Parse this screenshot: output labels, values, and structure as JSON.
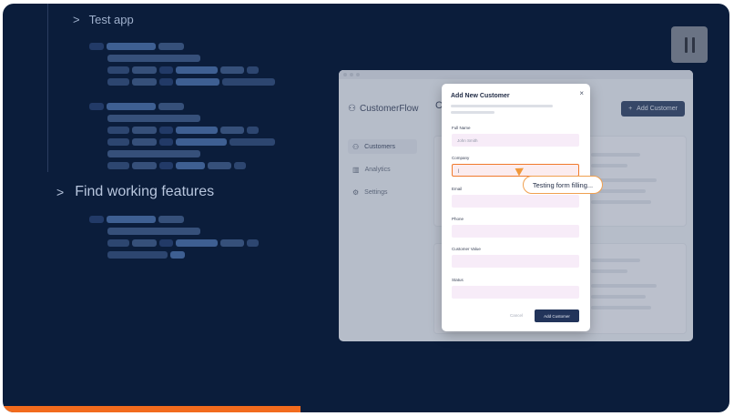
{
  "steps": [
    {
      "chevron": ">",
      "label": "Test app"
    },
    {
      "chevron": ">",
      "label": "Find working features"
    }
  ],
  "controls": {
    "pause_icon": "pause-icon"
  },
  "progress": {
    "fraction": 0.41,
    "color": "#f26b1d"
  },
  "app": {
    "brand": "CustomerFlow",
    "brand_icon": "users-icon",
    "nav": [
      {
        "icon": "users-icon",
        "label": "Customers",
        "active": true
      },
      {
        "icon": "chart-icon",
        "label": "Analytics",
        "active": false
      },
      {
        "icon": "gear-icon",
        "label": "Settings",
        "active": false
      }
    ],
    "page_title": "C",
    "add_button": {
      "icon": "+",
      "label": "Add Customer"
    }
  },
  "modal": {
    "title": "Add New Customer",
    "close": "×",
    "fields": [
      {
        "label": "Full Name",
        "value": "",
        "placeholder": "John Smith"
      },
      {
        "label": "Company",
        "value": "|",
        "placeholder": ""
      },
      {
        "label": "Email",
        "value": "",
        "placeholder": ""
      },
      {
        "label": "Phone",
        "value": "",
        "placeholder": ""
      },
      {
        "label": "Customer Value",
        "value": "",
        "placeholder": ""
      },
      {
        "label": "Status",
        "value": "",
        "placeholder": ""
      }
    ],
    "cancel": "Cancel",
    "submit": "Add Customer"
  },
  "tooltip": "Testing form filling..."
}
